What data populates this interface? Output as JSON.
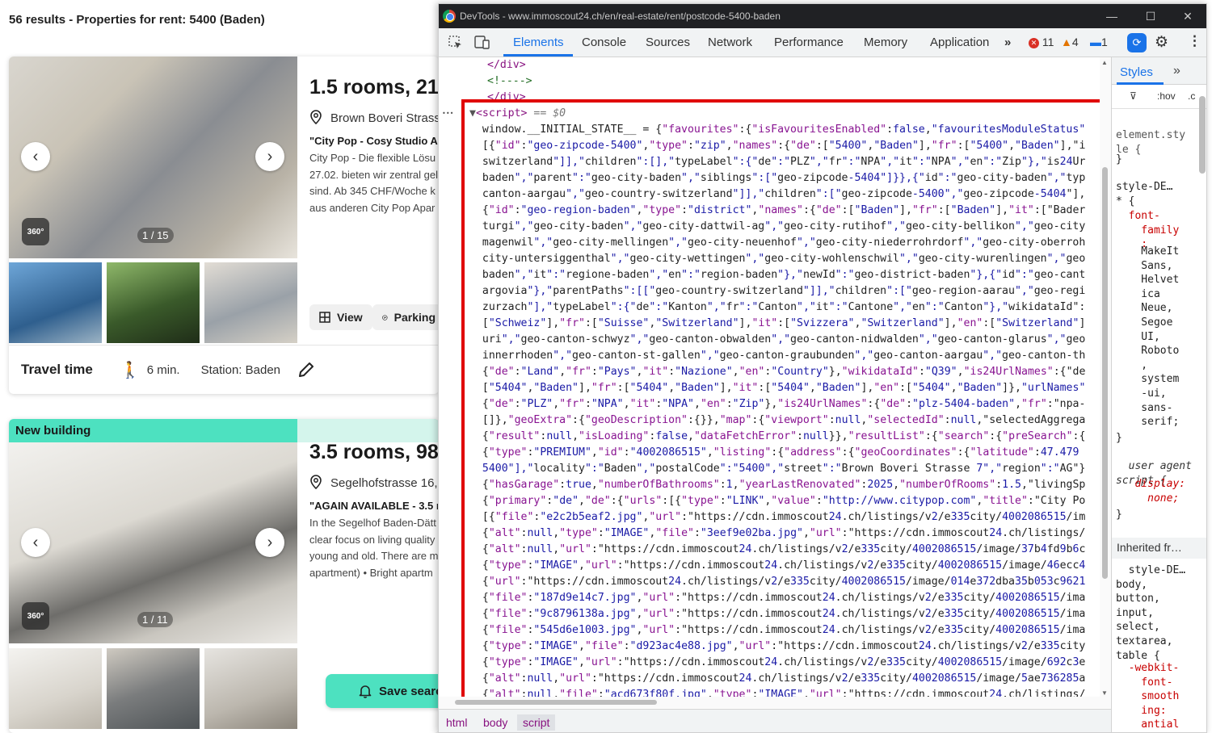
{
  "page": {
    "results_title": "56 results - Properties for rent: 5400 (Baden)"
  },
  "listing1": {
    "title": "1.5 rooms, 21m",
    "address": "Brown Boveri Strass",
    "subtitle": "\"City Pop - Cosy Studio A",
    "desc": [
      "City Pop - Die flexible Lösu",
      "27.02. bieten wir zentral gel",
      "sind. Ab 345 CHF/Woche k",
      "aus anderen City Pop Apar"
    ],
    "counter": "1 / 15",
    "badge_360": "360°",
    "view_label": "View",
    "parking_label": "Parking",
    "travel_label": "Travel time",
    "travel_minutes": "6 min.",
    "station": "Station: Baden"
  },
  "listing2": {
    "badge": "New building",
    "title": "3.5 rooms, 98",
    "address": "Segelhofstrasse 16,",
    "subtitle": "\"AGAIN AVAILABLE - 3.5 r",
    "desc": [
      "In the Segelhof Baden-Dätt",
      "clear focus on living quality",
      "young and old. There are m",
      "apartment) • Bright apartm"
    ],
    "counter": "1 / 11",
    "badge_360": "360°",
    "save_search": "Save searc"
  },
  "devtools": {
    "window_title": "DevTools - www.immoscout24.ch/en/real-estate/rent/postcode-5400-baden",
    "tabs": [
      "Elements",
      "Console",
      "Sources",
      "Network",
      "Performance",
      "Memory",
      "Application"
    ],
    "errors": "11",
    "warnings": "4",
    "messages": "1",
    "breadcrumbs": [
      "html",
      "body",
      "script"
    ],
    "styles_tab": "Styles",
    "code_lines": [
      "  </div>",
      "  <!---->",
      "</div>",
      "<script> == $0",
      "  window.__INITIAL_STATE__ = {\"favourites\":{\"isFavouritesEnabled\":false,\"favouritesModuleStatus\"",
      "  [{\"id\":\"geo-zipcode-5400\",\"type\":\"zip\",\"names\":{\"de\":[\"5400\",\"Baden\"],\"fr\":[\"5400\",\"Baden\"],\"i",
      "  switzerland\"]],\"children\":[],\"typeLabel\":{\"de\":\"PLZ\",\"fr\":\"NPA\",\"it\":\"NPA\",\"en\":\"Zip\"},\"is24Ur",
      "  baden\",\"parent\":\"geo-city-baden\",\"siblings\":[\"geo-zipcode-5404\"]}},{\"id\":\"geo-city-baden\",\"typ",
      "  canton-aargau\",\"geo-country-switzerland\"]],\"children\":[\"geo-zipcode-5400\",\"geo-zipcode-5404\"],",
      "  {\"id\":\"geo-region-baden\",\"type\":\"district\",\"names\":{\"de\":[\"Baden\"],\"fr\":[\"Baden\"],\"it\":[\"Bader",
      "  turgi\",\"geo-city-baden\",\"geo-city-dattwil-ag\",\"geo-city-rutihof\",\"geo-city-bellikon\",\"geo-city",
      "  magenwil\",\"geo-city-mellingen\",\"geo-city-neuenhof\",\"geo-city-niederrohrdorf\",\"geo-city-oberroh",
      "  city-untersiggenthal\",\"geo-city-wettingen\",\"geo-city-wohlenschwil\",\"geo-city-wurenlingen\",\"geo",
      "  baden\",\"it\":\"regione-baden\",\"en\":\"region-baden\"},\"newId\":\"geo-district-baden\"},{\"id\":\"geo-cant",
      "  argovia\"},\"parentPaths\":[[\"geo-country-switzerland\"]],\"children\":[\"geo-region-aarau\",\"geo-regi",
      "  zurzach\"],\"typeLabel\":{\"de\":\"Kanton\",\"fr\":\"Canton\",\"it\":\"Cantone\",\"en\":\"Canton\"},\"wikidataId\":",
      "  [\"Schweiz\"],\"fr\":[\"Suisse\",\"Switzerland\"],\"it\":[\"Svizzera\",\"Switzerland\"],\"en\":[\"Switzerland\"]",
      "  uri\",\"geo-canton-schwyz\",\"geo-canton-obwalden\",\"geo-canton-nidwalden\",\"geo-canton-glarus\",\"geo",
      "  innerrhoden\",\"geo-canton-st-gallen\",\"geo-canton-graubunden\",\"geo-canton-aargau\",\"geo-canton-th",
      "  {\"de\":\"Land\",\"fr\":\"Pays\",\"it\":\"Nazione\",\"en\":\"Country\"},\"wikidataId\":\"Q39\",\"is24UrlNames\":{\"de",
      "  [\"5404\",\"Baden\"],\"fr\":[\"5404\",\"Baden\"],\"it\":[\"5404\",\"Baden\"],\"en\":[\"5404\",\"Baden\"]},\"urlNames\"",
      "  {\"de\":\"PLZ\",\"fr\":\"NPA\",\"it\":\"NPA\",\"en\":\"Zip\"},\"is24UrlNames\":{\"de\":\"plz-5404-baden\",\"fr\":\"npa-",
      "  []},\"geoExtra\":{\"geoDescription\":{}},\"map\":{\"viewport\":null,\"selectedId\":null,\"selectedAggrega",
      "  {\"result\":null,\"isLoading\":false,\"dataFetchError\":null}},\"resultList\":{\"search\":{\"preSearch\":{",
      "  {\"type\":\"PREMIUM\",\"id\":\"4002086515\",\"listing\":{\"address\":{\"geoCoordinates\":{\"latitude\":47.479",
      "  5400\"],\"locality\":\"Baden\",\"postalCode\":\"5400\",\"street\":\"Brown Boveri Strasse 7\",\"region\":\"AG\"}",
      "  {\"hasGarage\":true,\"numberOfBathrooms\":1,\"yearLastRenovated\":2025,\"numberOfRooms\":1.5,\"livingSp",
      "  {\"primary\":\"de\",\"de\":{\"urls\":[{\"type\":\"LINK\",\"value\":\"http://www.citypop.com\",\"title\":\"City Po",
      "  [{\"file\":\"e2c2b5eaf2.jpg\",\"url\":\"https://cdn.immoscout24.ch/listings/v2/e335city/4002086515/im",
      "  {\"alt\":null,\"type\":\"IMAGE\",\"file\":\"3eef9e02ba.jpg\",\"url\":\"https://cdn.immoscout24.ch/listings/",
      "  {\"alt\":null,\"url\":\"https://cdn.immoscout24.ch/listings/v2/e335city/4002086515/image/37b4fd9b6c",
      "  {\"type\":\"IMAGE\",\"url\":\"https://cdn.immoscout24.ch/listings/v2/e335city/4002086515/image/46ecc4",
      "  {\"url\":\"https://cdn.immoscout24.ch/listings/v2/e335city/4002086515/image/014e372dba35b053c9621",
      "  {\"file\":\"187d9e14c7.jpg\",\"url\":\"https://cdn.immoscout24.ch/listings/v2/e335city/4002086515/ima",
      "  {\"file\":\"9c8796138a.jpg\",\"url\":\"https://cdn.immoscout24.ch/listings/v2/e335city/4002086515/ima",
      "  {\"file\":\"545d6e1003.jpg\",\"url\":\"https://cdn.immoscout24.ch/listings/v2/e335city/4002086515/ima",
      "  {\"type\":\"IMAGE\",\"file\":\"d923ac4e88.jpg\",\"url\":\"https://cdn.immoscout24.ch/listings/v2/e335city",
      "  {\"type\":\"IMAGE\",\"url\":\"https://cdn.immoscout24.ch/listings/v2/e335city/4002086515/image/692c3e",
      "  {\"alt\":null,\"url\":\"https://cdn.immoscout24.ch/listings/v2/e335city/4002086515/image/5ae736285a",
      "  {\"alt\":null,\"file\":\"acd673f80f.jpg\",\"type\":\"IMAGE\",\"url\":\"https://cdn.immoscout24.ch/listings/"
    ],
    "styles_lines": [
      {
        "text": "element.sty\nle {",
        "color": "#555"
      },
      {
        "text": "}",
        "color": "#222"
      },
      {
        "text": "style-DE…\n* {",
        "color": "#222"
      },
      {
        "text": "  font-\n    family\n    :",
        "color": "#c80000"
      },
      {
        "text": "    MakeIt\n    Sans,\n    Helvet\n    ica\n    Neue,\n    Segoe\n    UI,\n    Roboto\n    ,\n    system\n    -ui,\n    sans-\n    serif;",
        "color": "#222"
      },
      {
        "text": "}",
        "color": "#222"
      },
      {
        "text": "  user agent\nscript {",
        "color": "#333"
      },
      {
        "text": "   display:\n     none;",
        "color": "#c80000"
      },
      {
        "text": "}",
        "color": "#222"
      },
      {
        "text": "Inherited fr…",
        "color": "#333"
      },
      {
        "text": "  style-DE…\nbody,\nbutton,\ninput,\nselect,\ntextarea,\ntable {",
        "color": "#222"
      },
      {
        "text": "  -webkit-\n    font-\n    smooth\n    ing:\n    antial",
        "color": "#c80000"
      }
    ]
  }
}
